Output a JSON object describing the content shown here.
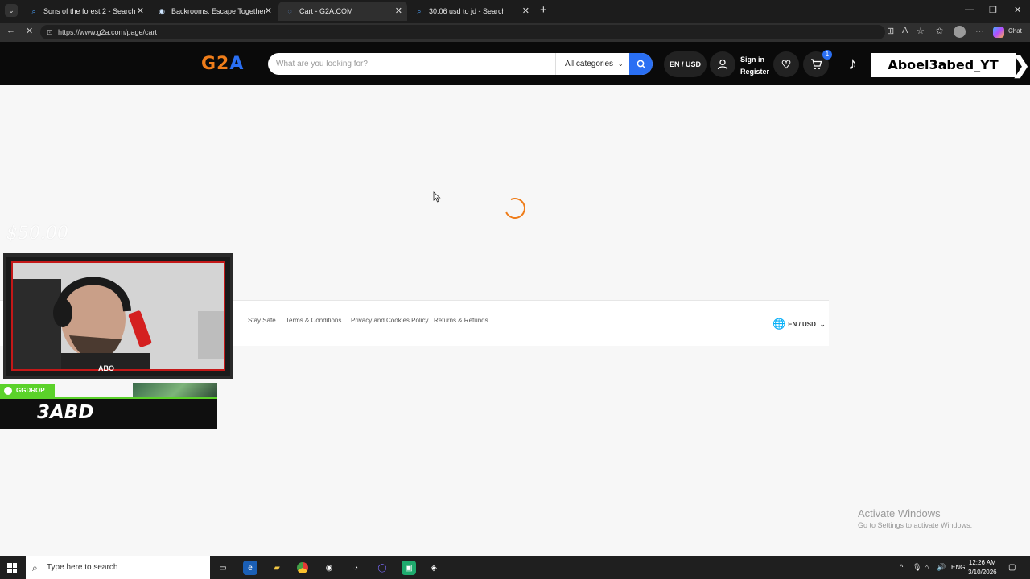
{
  "browser": {
    "tabs": [
      {
        "label": "Sons of the forest 2 - Search",
        "active": false
      },
      {
        "label": "Backrooms: Escape Together on St",
        "active": false
      },
      {
        "label": "Cart - G2A.COM",
        "active": true
      },
      {
        "label": "30.06 usd to jd - Search",
        "active": false
      }
    ],
    "url": "https://www.g2a.com/page/cart",
    "chat_label": "Chat"
  },
  "header": {
    "logo": "G2A",
    "search_placeholder": "What are you looking for?",
    "category_label": "All categories",
    "locale_label": "EN / USD",
    "sign_in": "Sign in",
    "register": "Register",
    "cart_count": "1"
  },
  "overlay": {
    "tiktok_handle": "Aboel3abed_YT",
    "ghost_price": "$50.00",
    "cam_label": "ABO",
    "ggdrop_badge": "GGDROP",
    "ggdrop_name": "3ABD"
  },
  "footer": {
    "links": [
      "Stay Safe",
      "Terms & Conditions",
      "Privacy and Cookies Policy",
      "Returns & Refunds"
    ],
    "lang": "EN / USD"
  },
  "watermark": {
    "title": "Activate Windows",
    "subtitle": "Go to Settings to activate Windows."
  },
  "taskbar": {
    "search_placeholder": "Type here to search",
    "tray_lang": "ENG",
    "time": "12:26 AM",
    "date": "3/10/2026"
  },
  "colors": {
    "accent_orange": "#ef7d1a",
    "accent_blue": "#2a6ff3",
    "ggdrop_green": "#5bd22a"
  }
}
